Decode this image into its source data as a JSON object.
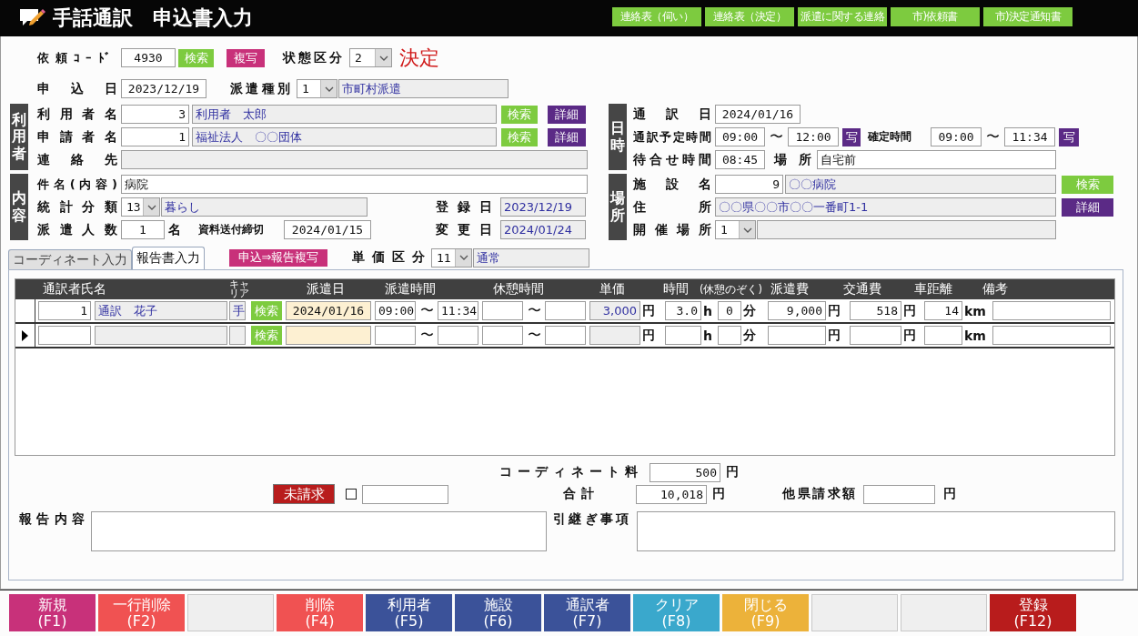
{
  "header": {
    "title": "手話通訳　申込書入力",
    "buttons": [
      "連絡表（伺い）",
      "連絡表（決定）",
      "派遣に関する連絡",
      "市)依頼書",
      "市)決定通知書"
    ]
  },
  "top_rows": [
    {
      "label": "依頼ｺｰﾄﾞ",
      "items": [
        {
          "kind": "center",
          "value": "4930"
        },
        {
          "kind": "search_button",
          "text": "検索"
        },
        {
          "kind": "copy_button",
          "text": "複写"
        },
        {
          "kind": "text",
          "text": "状態区分"
        },
        {
          "kind": "select",
          "value": "2"
        },
        {
          "kind": "status",
          "text": "決定"
        }
      ]
    },
    {
      "label": "申込日",
      "items": [
        {
          "kind": "center",
          "value": "2023/12/19"
        },
        {
          "kind": "text",
          "text": "派遣種別"
        },
        {
          "kind": "select",
          "value": "1"
        },
        {
          "kind": "readonly",
          "value": "市町村派遣"
        }
      ]
    }
  ],
  "left_sections": [
    {
      "title": "利用者",
      "rows": [
        {
          "label": "利用者名",
          "items": [
            {
              "kind": "number",
              "value": "3"
            },
            {
              "kind": "readonly",
              "value": "利用者　太郎"
            },
            {
              "kind": "search_button",
              "text": "検索"
            },
            {
              "kind": "detail_button",
              "text": "詳細"
            }
          ]
        },
        {
          "label": "申請者名",
          "items": [
            {
              "kind": "number",
              "value": "1"
            },
            {
              "kind": "readonly",
              "value": "福祉法人　〇〇団体"
            },
            {
              "kind": "search_button",
              "text": "検索"
            },
            {
              "kind": "detail_button",
              "text": "詳細"
            }
          ]
        },
        {
          "label": "連絡先",
          "items": [
            {
              "kind": "readonly"
            }
          ]
        }
      ]
    },
    {
      "title": "内容",
      "rows": [
        {
          "label": "件名(内容)",
          "items": [
            {
              "kind": "input",
              "value": "病院"
            }
          ]
        },
        {
          "label": "統計分類",
          "items": [
            {
              "kind": "select",
              "value": "13"
            },
            {
              "kind": "readonly",
              "value": "暮らし"
            },
            {
              "kind": "text",
              "text": "登録日"
            },
            {
              "kind": "readonly",
              "value": "2023/12/19"
            }
          ]
        },
        {
          "label": "派遣人数",
          "items": [
            {
              "kind": "center",
              "value": "1"
            },
            {
              "kind": "text",
              "text": "名"
            },
            {
              "kind": "small_text",
              "text": "資料送付締切"
            },
            {
              "kind": "center",
              "value": "2024/01/15"
            },
            {
              "kind": "text",
              "text": "変更日"
            },
            {
              "kind": "readonly",
              "value": "2024/01/24"
            }
          ]
        }
      ]
    }
  ],
  "right_sections": [
    {
      "title": "日時",
      "rows": [
        {
          "label": "通訳日",
          "items": [
            {
              "kind": "center",
              "value": "2024/01/16"
            }
          ]
        },
        {
          "label": "通訳予定時間",
          "items": [
            {
              "kind": "center",
              "value": "09:00"
            },
            {
              "kind": "sep",
              "text": "〜"
            },
            {
              "kind": "center",
              "value": "12:00"
            },
            {
              "kind": "time_copy_button",
              "text": "写"
            },
            {
              "kind": "small_text",
              "text": "確定時間"
            },
            {
              "kind": "center",
              "value": "09:00"
            },
            {
              "kind": "sep",
              "text": "〜"
            },
            {
              "kind": "center",
              "value": "11:34"
            },
            {
              "kind": "time_copy_button",
              "text": "写"
            }
          ]
        },
        {
          "label": "待合せ時間",
          "items": [
            {
              "kind": "center",
              "value": "08:45"
            },
            {
              "kind": "text",
              "text": "場所"
            },
            {
              "kind": "input",
              "value": "自宅前"
            }
          ]
        }
      ]
    },
    {
      "title": "場所",
      "rows": [
        {
          "label": "施設名",
          "items": [
            {
              "kind": "number",
              "value": "9"
            },
            {
              "kind": "readonly",
              "value": "〇〇病院"
            },
            {
              "kind": "search_button",
              "text": "検索"
            }
          ]
        },
        {
          "label": "住所",
          "items": [
            {
              "kind": "readonly",
              "value": "〇〇県〇〇市〇〇一番町1-1"
            },
            {
              "kind": "detail_button",
              "text": "詳細"
            }
          ]
        },
        {
          "label": "開催場所",
          "items": [
            {
              "kind": "select",
              "value": "1"
            },
            {
              "kind": "readonly"
            }
          ]
        }
      ]
    }
  ],
  "tabs": [
    {
      "label": "コーディネート入力",
      "selected": false
    },
    {
      "label": "報告書入力",
      "selected": true
    }
  ],
  "copy_button": "申込⇒報告複写",
  "unit_class": {
    "label": "単価区分",
    "value": "11",
    "name": "通常"
  },
  "table": {
    "columns": [
      "通訳者氏名",
      "キャリア",
      "派遣日",
      "派遣時間",
      "休憩時間",
      "単価",
      "時間",
      "(休憩のぞく)",
      "派遣費",
      "交通費",
      "車距離",
      "備考"
    ],
    "rows": [
      {
        "current": false,
        "cells": [
          [
            {
              "kind": "number",
              "value": "1"
            },
            {
              "kind": "readonly",
              "value": "通訳　花子"
            }
          ],
          [
            {
              "kind": "readonly",
              "value": "手"
            },
            {
              "kind": "search_button",
              "text": "検索"
            }
          ],
          [
            {
              "kind": "date",
              "value": "2024/01/16"
            }
          ],
          [
            {
              "kind": "center",
              "value": "09:00"
            },
            {
              "kind": "sep",
              "text": "〜"
            },
            {
              "kind": "center",
              "value": "11:34"
            }
          ],
          [
            {
              "kind": "input"
            },
            {
              "kind": "sep",
              "text": "〜"
            },
            {
              "kind": "input"
            }
          ],
          [
            {
              "kind": "readonly_number",
              "value": "3,000"
            },
            {
              "kind": "unit",
              "text": "円"
            }
          ],
          [
            {
              "kind": "number",
              "value": "3.0"
            },
            {
              "kind": "unit",
              "text": "h"
            }
          ],
          [
            {
              "kind": "center",
              "value": "0"
            },
            {
              "kind": "unit",
              "text": "分"
            }
          ],
          [
            {
              "kind": "number",
              "value": "9,000"
            },
            {
              "kind": "unit",
              "text": "円"
            }
          ],
          [
            {
              "kind": "number",
              "value": "518"
            },
            {
              "kind": "unit",
              "text": "円"
            }
          ],
          [
            {
              "kind": "number",
              "value": "14"
            },
            {
              "kind": "unit",
              "text": "km"
            }
          ],
          [
            {
              "kind": "input"
            }
          ]
        ]
      },
      {
        "current": true,
        "cells": [
          [
            {
              "kind": "number"
            },
            {
              "kind": "readonly"
            }
          ],
          [
            {
              "kind": "readonly"
            },
            {
              "kind": "search_button",
              "text": "検索"
            }
          ],
          [
            {
              "kind": "date"
            }
          ],
          [
            {
              "kind": "center"
            },
            {
              "kind": "sep",
              "text": "〜"
            },
            {
              "kind": "center"
            }
          ],
          [
            {
              "kind": "input"
            },
            {
              "kind": "sep",
              "text": "〜"
            },
            {
              "kind": "input"
            }
          ],
          [
            {
              "kind": "readonly_number"
            },
            {
              "kind": "unit",
              "text": "円"
            }
          ],
          [
            {
              "kind": "number"
            },
            {
              "kind": "unit",
              "text": "h"
            }
          ],
          [
            {
              "kind": "center"
            },
            {
              "kind": "unit",
              "text": "分"
            }
          ],
          [
            {
              "kind": "number"
            },
            {
              "kind": "unit",
              "text": "円"
            }
          ],
          [
            {
              "kind": "number"
            },
            {
              "kind": "unit",
              "text": "円"
            }
          ],
          [
            {
              "kind": "number"
            },
            {
              "kind": "unit",
              "text": "km"
            }
          ],
          [
            {
              "kind": "input"
            }
          ]
        ]
      }
    ]
  },
  "summary": {
    "coordinate_fee": {
      "label": "コーディネート料",
      "value": "500",
      "unit": "円"
    },
    "billing_status": "未請求",
    "billing_checked": false,
    "total": {
      "label": "合計",
      "value": "10,018",
      "unit": "円"
    },
    "other_prefecture": {
      "label": "他県請求額",
      "unit": "円"
    },
    "report": {
      "label": "報告内容"
    },
    "handover": {
      "label": "引継ぎ事項"
    }
  },
  "function_keys": [
    {
      "kind": "new",
      "label": "新規",
      "key": "(F1)"
    },
    {
      "kind": "delete",
      "label": "一行削除",
      "key": "(F2)"
    },
    {
      "kind": "blank"
    },
    {
      "kind": "delete",
      "label": "削除",
      "key": "(F4)"
    },
    {
      "kind": "nav",
      "label": "利用者",
      "key": "(F5)"
    },
    {
      "kind": "nav",
      "label": "施設",
      "key": "(F6)"
    },
    {
      "kind": "nav",
      "label": "通訳者",
      "key": "(F7)"
    },
    {
      "kind": "clear",
      "label": "クリア",
      "key": "(F8)"
    },
    {
      "kind": "close",
      "label": "閉じる",
      "key": "(F9)"
    },
    {
      "kind": "blank"
    },
    {
      "kind": "blank"
    },
    {
      "kind": "register",
      "label": "登録",
      "key": "(F12)"
    }
  ]
}
